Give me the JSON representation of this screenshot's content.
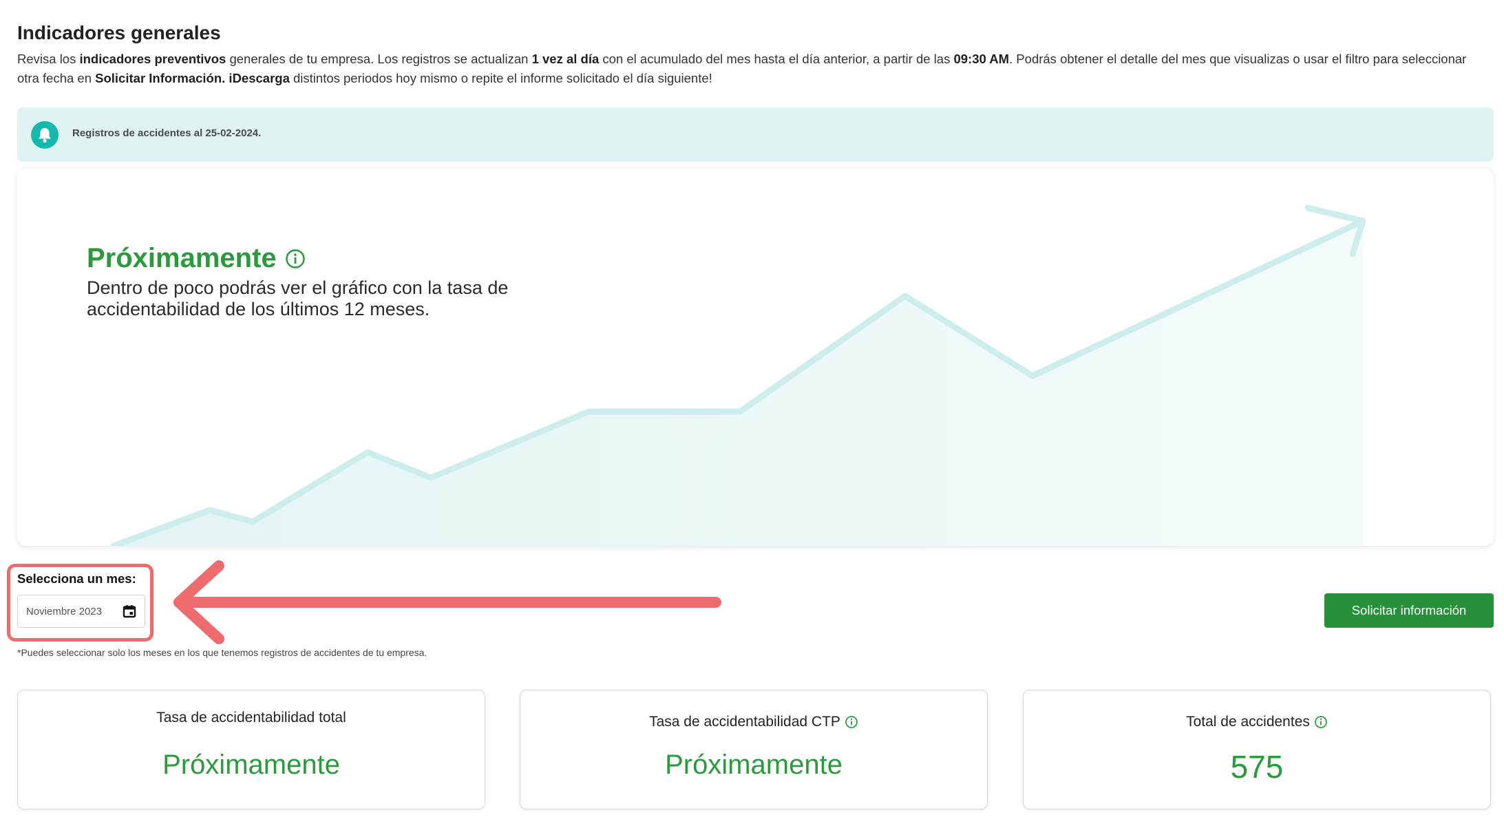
{
  "header": {
    "title": "Indicadores generales",
    "desc": {
      "p1": "Revisa los ",
      "b1": "indicadores preventivos",
      "p2": " generales de tu empresa. Los registros se actualizan ",
      "b2": "1 vez al día",
      "p3": " con el acumulado del mes hasta el día anterior, a partir de las ",
      "b3": "09:30 AM",
      "p4": ". Podrás obtener el detalle del mes que visualizas o usar el filtro para seleccionar otra fecha en ",
      "b4": "Solicitar Información. iDescarga",
      "p5": " distintos periodos hoy mismo o repite el informe solicitado el día siguiente!"
    }
  },
  "notice": {
    "icon": "bell-icon",
    "text": "Registros de accidentes al 25-02-2024."
  },
  "chart_placeholder": {
    "title": "Próximamente",
    "description": "Dentro de poco podrás ver el gráfico con la tasa de accidentabilidad de los últimos 12 meses.",
    "line_color": "#cdeeed",
    "fill_color": "#e9f6f6"
  },
  "filter": {
    "label": "Selecciona un mes:",
    "value": "Noviembre 2023",
    "icon": "calendar-icon",
    "note": "*Puedes seleccionar solo los meses en los que tenemos registros de accidentes de tu empresa.",
    "highlight_color": "#ee6b6e"
  },
  "actions": {
    "request_button": "Solicitar información"
  },
  "metrics": [
    {
      "label": "Tasa de accidentabilidad total",
      "value": "Próximamente"
    },
    {
      "label": "Tasa de accidentabilidad CTP",
      "value": "Próximamente"
    },
    {
      "label": "Total de accidentes",
      "value": "575"
    }
  ],
  "colors": {
    "primary_green": "#27913a",
    "text_green": "#2a9a3d",
    "teal": "#15b8ad",
    "notice_bg": "#dff3f2"
  }
}
